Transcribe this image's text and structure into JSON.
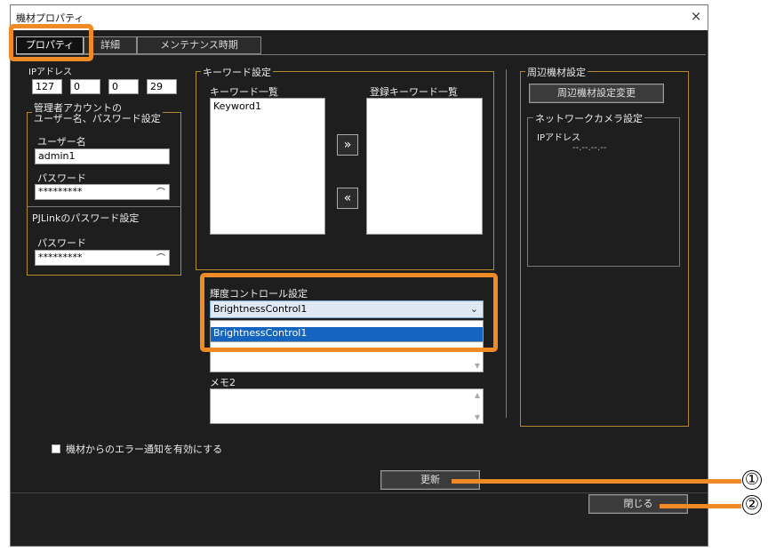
{
  "window": {
    "title": "機材プロパティ",
    "close_glyph": "×"
  },
  "tabs": [
    {
      "label": "プロパティ",
      "active": true
    },
    {
      "label": "詳細",
      "active": false
    },
    {
      "label": "メンテナンス時期",
      "active": false
    }
  ],
  "ip": {
    "label": "IPアドレス",
    "octets": [
      "127",
      "0",
      "0",
      "29"
    ]
  },
  "admin": {
    "title_line1": "管理者アカウントの",
    "title_line2": "ユーザー名、パスワード設定",
    "username_label": "ユーザー名",
    "username_value": "admin1",
    "password_label": "パスワード",
    "password_value": "*********"
  },
  "pjlink": {
    "title": "PJLinkのパスワード設定",
    "password_label": "パスワード",
    "password_value": "*********"
  },
  "keyword": {
    "group_title": "キーワード設定",
    "list_label": "キーワード一覧",
    "registered_label": "登録キーワード一覧",
    "items": [
      "Keyword1"
    ],
    "registered_items": [],
    "add_glyph": "»",
    "remove_glyph": "«"
  },
  "brightness": {
    "label": "輝度コントロール設定",
    "selected": "BrightnessControl1",
    "options": [
      "BrightnessControl1"
    ]
  },
  "memo2": {
    "label": "メモ2"
  },
  "peripheral": {
    "group_title": "周辺機材設定",
    "change_button": "周辺機材設定変更",
    "camera_title": "ネットワークカメラ設定",
    "camera_ip_label": "IPアドレス",
    "camera_ip_value": "--.--.--.--"
  },
  "error_notify_label": "機材からのエラー通知を有効にする",
  "update_button": "更新",
  "close_button": "閉じる",
  "callouts": [
    "①",
    "②"
  ],
  "colors": {
    "highlight": "#f08a24",
    "group_border": "#b08a2c",
    "selection": "#1565c0"
  }
}
